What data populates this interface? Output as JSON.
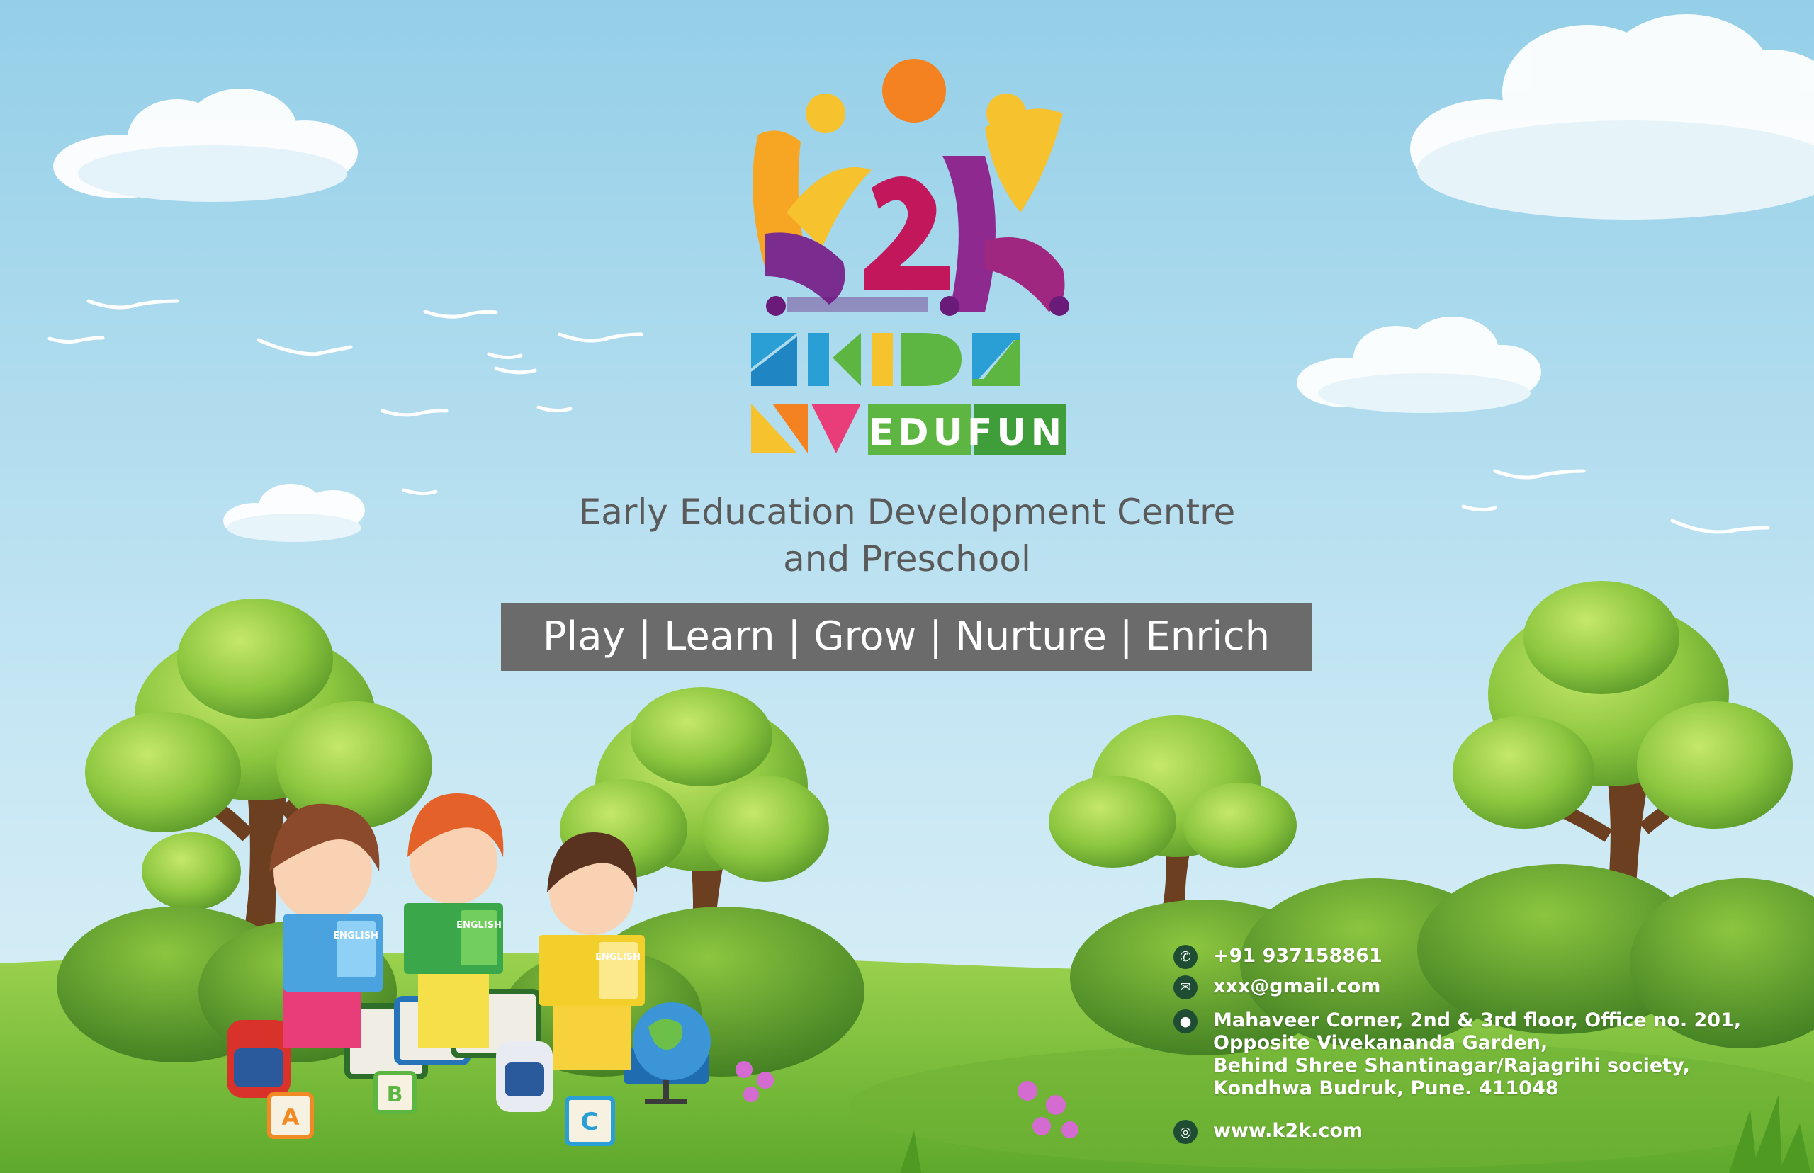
{
  "logo": {
    "mark": "k2k",
    "wordmark_top": "KIDZ",
    "wordmark_bottom": "EDUFUN",
    "colors": {
      "orange": "#f58220",
      "yellow": "#f6c22d",
      "purple": "#7b2c8f",
      "magenta": "#c2185b",
      "blue": "#2a9fd6",
      "green": "#5db542"
    }
  },
  "tagline": {
    "line1": "Early Education Development Centre",
    "line2": "and Preschool"
  },
  "motto": "Play | Learn | Grow | Nurture | Enrich",
  "contact": {
    "phone": "+91 937158861",
    "email": "xxx@gmail.com",
    "address_lines": [
      "Mahaveer Corner, 2nd & 3rd floor, Office no. 201,",
      "Opposite Vivekananda Garden,",
      "Behind Shree Shantinagar/Rajagrihi society,",
      "Kondhwa Budruk, Pune. 411048"
    ],
    "website": "www.k2k.com"
  },
  "icons": [
    "phone-icon",
    "mail-icon",
    "location-icon",
    "globe-icon"
  ],
  "illustration": {
    "books": [
      {
        "label": "ENGLISH",
        "blocks": "A B C"
      },
      {
        "label": "ENGLISH",
        "blocks": "A B C"
      },
      {
        "label": "ENGLISH",
        "blocks": "A B C"
      }
    ],
    "cubes": [
      "A",
      "B",
      "C"
    ]
  },
  "colors": {
    "sky_top": "#9fd3ea",
    "sky_bottom": "#d8eef6",
    "grass": "#7cc142",
    "motto_bg": "#6b6b6b",
    "text_gray": "#5a5a5a"
  }
}
